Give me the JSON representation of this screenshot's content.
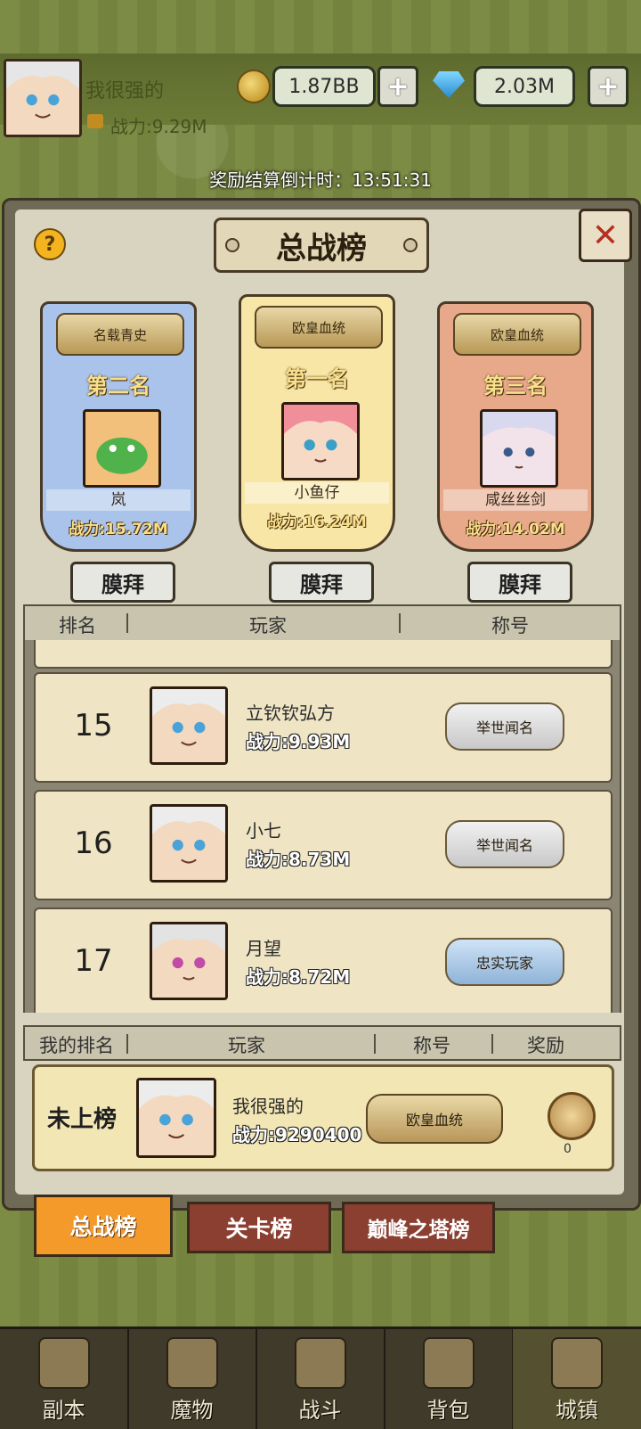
{
  "header": {
    "player_name": "我很强的",
    "power": "战力:9.29M",
    "gold": "1.87BB",
    "gems": "2.03M",
    "plus_label": "+",
    "countdown": "奖励结算倒计时：13:51:31"
  },
  "panel": {
    "title": "总战榜",
    "help_label": "?",
    "close_label": "✕"
  },
  "podium": [
    {
      "place": "第二名",
      "badge": "名载青史",
      "name": "岚",
      "power": "战力:15.72M",
      "bg": "#a9c3ea"
    },
    {
      "place": "第一名",
      "badge": "欧皇血统",
      "name": "小鱼仔",
      "power": "战力:16.24M",
      "bg": "#f7e6a6"
    },
    {
      "place": "第三名",
      "badge": "欧皇血统",
      "name": "咸丝丝剑",
      "power": "战力:14.02M",
      "bg": "#e8a98b"
    }
  ],
  "worship_label": "膜拜",
  "table_head": {
    "rank": "排名",
    "player": "玩家",
    "title": "称号"
  },
  "rows": [
    {
      "rank": "15",
      "name": "立钦钦弘方",
      "power": "战力:9.93M",
      "title": "举世闻名"
    },
    {
      "rank": "16",
      "name": "小七",
      "power": "战力:8.73M",
      "title": "举世闻名"
    },
    {
      "rank": "17",
      "name": "月望",
      "power": "战力:8.72M",
      "title": "忠实玩家"
    }
  ],
  "my_head": {
    "rank": "我的排名",
    "player": "玩家",
    "title": "称号",
    "reward": "奖励"
  },
  "my_row": {
    "status": "未上榜",
    "name": "我很强的",
    "power": "战力:9290400",
    "title": "欧皇血统",
    "reward_count": "0"
  },
  "tabs": [
    "总战榜",
    "关卡榜",
    "巅峰之塔榜"
  ],
  "nav": [
    {
      "label": "副本",
      "icon": "map-icon"
    },
    {
      "label": "魔物",
      "icon": "monster-icon"
    },
    {
      "label": "战斗",
      "icon": "swords-icon"
    },
    {
      "label": "背包",
      "icon": "backpack-icon"
    },
    {
      "label": "城镇",
      "icon": "castle-icon"
    }
  ],
  "colors": {
    "accent": "#f39a2b",
    "tab_inactive": "#8a3f30"
  }
}
